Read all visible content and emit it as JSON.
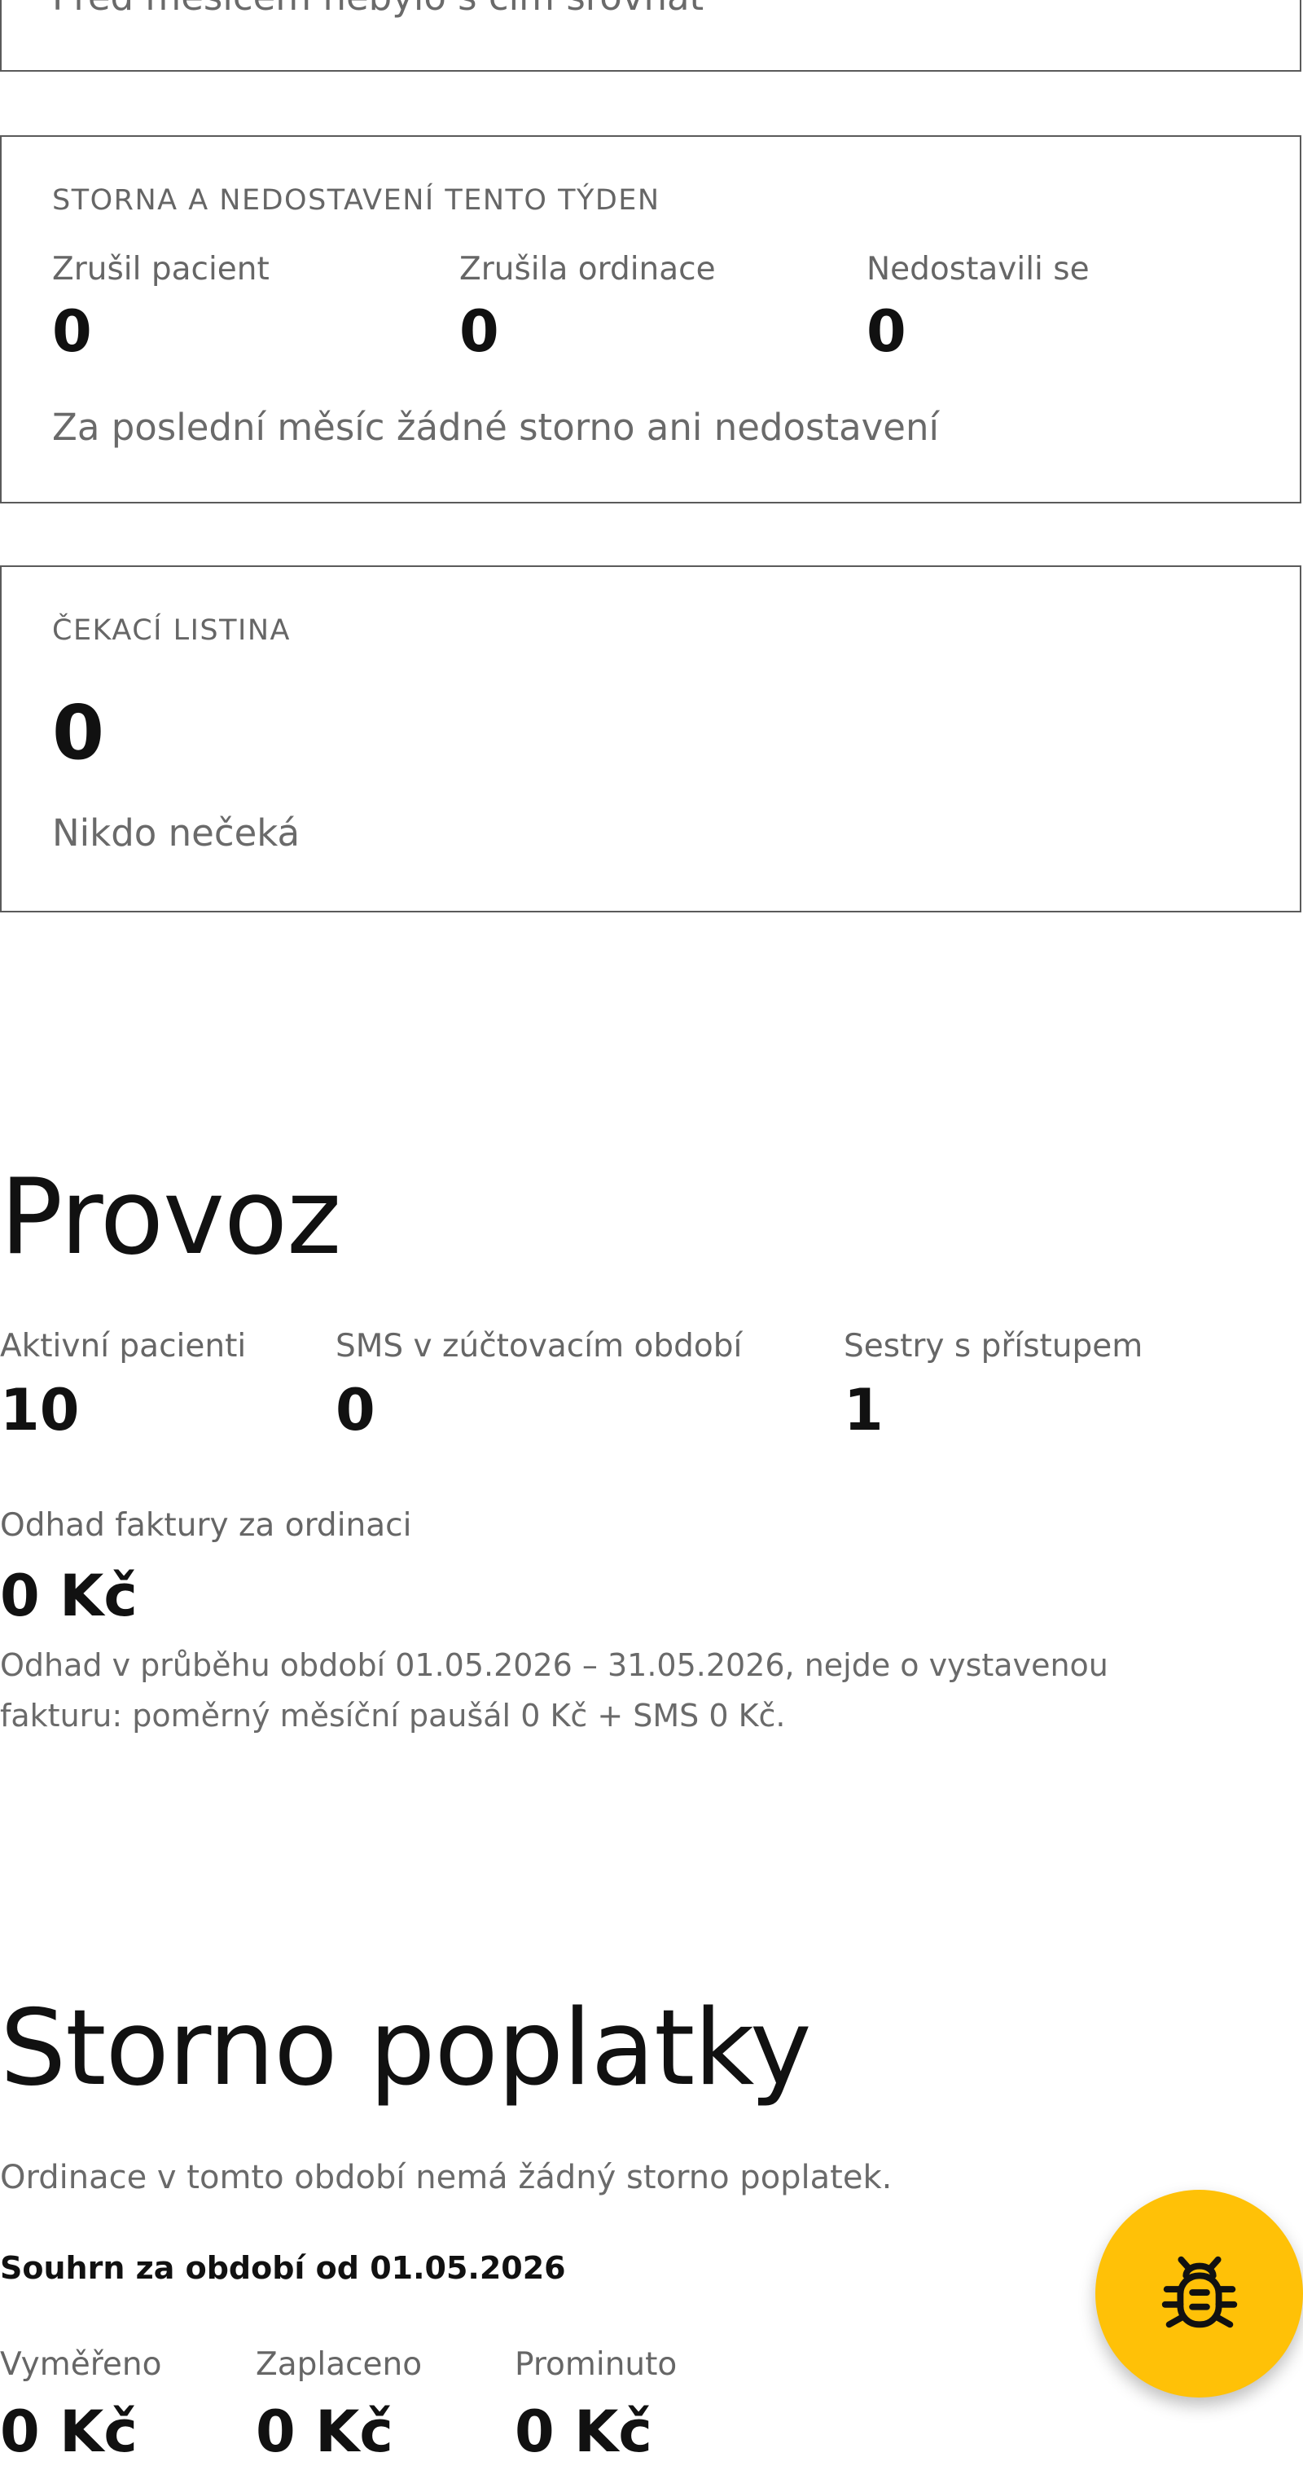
{
  "top_card": {
    "note": "Před měsícem nebylo s čím srovnat"
  },
  "cancellations": {
    "title": "STORNA A NEDOSTAVENÍ TENTO TÝDEN",
    "stats": [
      {
        "label": "Zrušil pacient",
        "value": "0"
      },
      {
        "label": "Zrušila ordinace",
        "value": "0"
      },
      {
        "label": "Nedostavili se",
        "value": "0"
      }
    ],
    "note": "Za poslední měsíc žádné storno ani nedostavení"
  },
  "waitlist": {
    "title": "ČEKACÍ LISTINA",
    "value": "0",
    "note": "Nikdo nečeká"
  },
  "operations": {
    "heading": "Provoz",
    "stats": [
      {
        "label": "Aktivní pacienti",
        "value": "10"
      },
      {
        "label": "SMS v zúčtovacím období",
        "value": "0"
      },
      {
        "label": "Sestry s přístupem",
        "value": "1"
      }
    ],
    "invoice_label": "Odhad faktury za ordinaci",
    "invoice_value": "0 Kč",
    "invoice_note_line1": "Odhad v průběhu období 01.05.2026 – 31.05.2026, nejde o vystavenou",
    "invoice_note_line2": "fakturu: poměrný měsíční paušál 0 Kč + SMS 0 Kč."
  },
  "fees": {
    "heading": "Storno poplatky",
    "note": "Ordinace v tomto období nemá žádný storno poplatek.",
    "summary_title": "Souhrn za období od 01.05.2026",
    "stats": [
      {
        "label": "Vyměřeno",
        "value": "0 Kč"
      },
      {
        "label": "Zaplaceno",
        "value": "0 Kč"
      },
      {
        "label": "Prominuto",
        "value": "0 Kč"
      }
    ]
  },
  "bug_button": {
    "icon": "bug-icon",
    "color": "#ffc107"
  }
}
